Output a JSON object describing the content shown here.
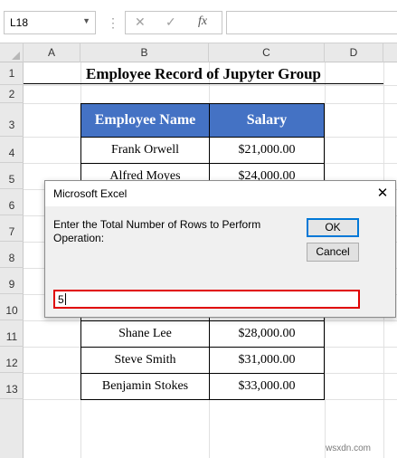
{
  "formula_bar": {
    "name_box": "L18",
    "cancel_symbol": "✕",
    "enter_symbol": "✓",
    "fx_label": "fx",
    "formula_value": ""
  },
  "columns": [
    "A",
    "B",
    "C",
    "D"
  ],
  "rows": [
    "1",
    "2",
    "3",
    "4",
    "5",
    "6",
    "7",
    "8",
    "9",
    "10",
    "11",
    "12",
    "13"
  ],
  "sheet": {
    "title": "Employee Record of Jupyter Group",
    "headers": {
      "name": "Employee Name",
      "salary": "Salary"
    },
    "records": [
      {
        "name": "Frank Orwell",
        "salary": "$21,000.00"
      },
      {
        "name": "Alfred Moyes",
        "salary": "$24,000.00"
      },
      {
        "name": "Shane Lee",
        "salary": "$28,000.00"
      },
      {
        "name": "Steve Smith",
        "salary": "$31,000.00"
      },
      {
        "name": "Benjamin Stokes",
        "salary": "$33,000.00"
      }
    ]
  },
  "dialog": {
    "title": "Microsoft Excel",
    "close_symbol": "✕",
    "prompt": "Enter the Total Number of Rows to Perform Operation:",
    "ok_label": "OK",
    "cancel_label": "Cancel",
    "input_value": "5"
  },
  "watermark": "wsxdn.com",
  "colors": {
    "header_fill": "#4472c4",
    "input_highlight": "#e00000",
    "ok_focus": "#0078d7"
  }
}
